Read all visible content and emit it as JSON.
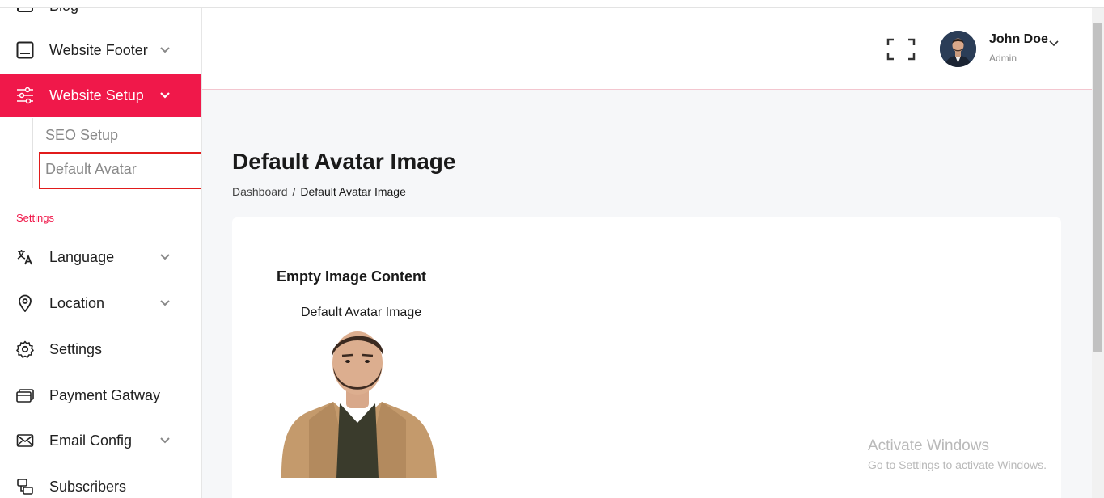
{
  "sidebar": {
    "items": [
      {
        "label": "Blog",
        "icon": "blog-icon"
      },
      {
        "label": "Website Footer",
        "icon": "footer-icon"
      },
      {
        "label": "Website Setup",
        "icon": "sliders-icon"
      },
      {
        "label": "Language",
        "icon": "translate-icon"
      },
      {
        "label": "Location",
        "icon": "location-pin-icon"
      },
      {
        "label": "Settings",
        "icon": "gear-icon"
      },
      {
        "label": "Payment Gatway",
        "icon": "credit-card-icon"
      },
      {
        "label": "Email Config",
        "icon": "envelope-icon"
      },
      {
        "label": "Subscribers",
        "icon": "subscribers-icon"
      }
    ],
    "submenu": [
      {
        "label": "SEO Setup"
      },
      {
        "label": "Default Avatar"
      }
    ],
    "section_title": "Settings",
    "accent_color": "#f0184a"
  },
  "header": {
    "user_name": "John Doe",
    "user_role": "Admin"
  },
  "main": {
    "page_title": "Default Avatar Image",
    "breadcrumb": [
      "Dashboard",
      "/",
      "Default Avatar Image"
    ],
    "card_title": "Empty Image Content",
    "image_caption": "Default Avatar Image"
  },
  "watermark": {
    "line1": "Activate Windows",
    "line2": "Go to Settings to activate Windows."
  }
}
